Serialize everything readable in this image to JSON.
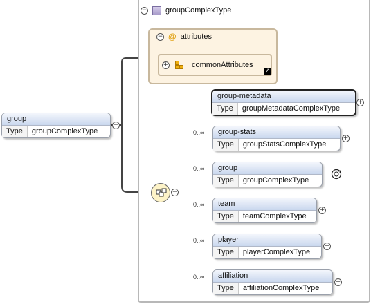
{
  "root": {
    "name": "group",
    "type_key": "Type",
    "type": "groupComplexType"
  },
  "complex_type": {
    "title": "groupComplexType"
  },
  "attributes": {
    "label": "attributes",
    "group_ref": "commonAttributes"
  },
  "children": [
    {
      "name": "group-metadata",
      "type_key": "Type",
      "type": "groupMetadataComplexType",
      "cardinality": ""
    },
    {
      "name": "group-stats",
      "type_key": "Type",
      "type": "groupStatsComplexType",
      "cardinality": "0..∞"
    },
    {
      "name": "group",
      "type_key": "Type",
      "type": "groupComplexType",
      "cardinality": "0..∞"
    },
    {
      "name": "team",
      "type_key": "Type",
      "type": "teamComplexType",
      "cardinality": "0..∞"
    },
    {
      "name": "player",
      "type_key": "Type",
      "type": "playerComplexType",
      "cardinality": "0..∞"
    },
    {
      "name": "affiliation",
      "type_key": "Type",
      "type": "affiliationComplexType",
      "cardinality": "0..∞"
    }
  ],
  "icons": {
    "collapse": "minus-circle-icon",
    "expand": "plus-circle-icon",
    "recursion": "recursion-icon",
    "sequence": "sequence-compositor-icon"
  },
  "colors": {
    "element_header": "#c9d7ee",
    "attributes_bg": "#fdf3e2",
    "frame": "#b8b8b8"
  }
}
